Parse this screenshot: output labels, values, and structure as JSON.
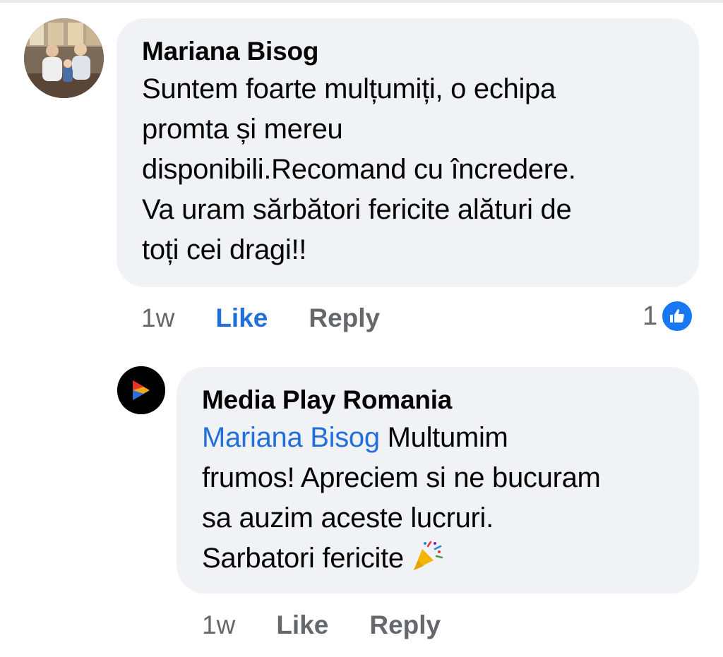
{
  "comment": {
    "author": "Mariana Bisog",
    "text": "Suntem foarte mulțumiți, o echipa\npromta și mereu\ndisponibili.Recomand cu încredere.\nVa uram sărbători fericite alături de\ntoți cei dragi!!",
    "time": "1w",
    "like_label": "Like",
    "reply_label": "Reply",
    "reaction_count": "1",
    "reaction_icon": "thumbs-up-icon",
    "liked": true
  },
  "reply": {
    "author": "Media Play Romania",
    "mention": "Mariana Bisog",
    "text": " Multumim\nfrumos! Apreciem si ne bucuram\nsa auzim aceste lucruri.\nSarbatori fericite",
    "emoji": "party-popper-icon",
    "time": "1w",
    "like_label": "Like",
    "reply_label": "Reply"
  },
  "colors": {
    "bubble": "#f0f2f5",
    "link": "#216fdb",
    "meta": "#65676b",
    "like_badge": "#1877f2"
  }
}
